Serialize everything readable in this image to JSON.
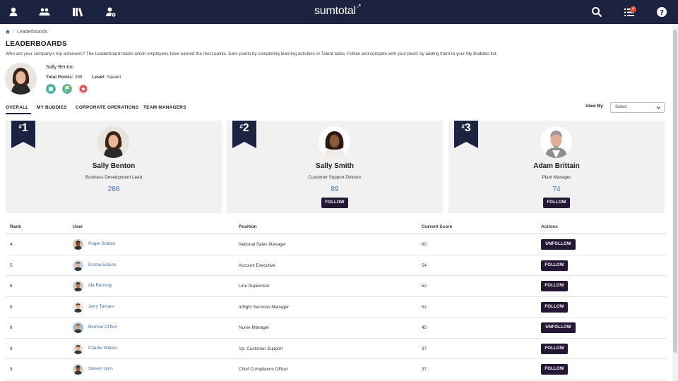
{
  "brand": {
    "name": "sumtotal"
  },
  "notifications": {
    "count": "4"
  },
  "breadcrumb": {
    "current": "Leaderboards"
  },
  "page": {
    "title": "LEADERBOARDS",
    "description": "Who are your company's top achievers? The Leaderboard tracks which employees have earned the most points. Earn points by completing learning activities or Talent tasks. Follow and compete with your peers by adding them to your My Buddies list."
  },
  "me": {
    "name": "Sally Benton",
    "total_points_label": "Total Points:",
    "total_points": "288",
    "level_label": "Level:",
    "level": "Savant"
  },
  "tabs": [
    "OVERALL",
    "MY BUDDIES",
    "CORPORATE OPERATIONS",
    "TEAM MANAGERS"
  ],
  "view_by": {
    "label": "View By",
    "selected": "Select"
  },
  "top3": [
    {
      "rank": "1",
      "name": "Sally Benton",
      "title": "Business Development Lead",
      "score": "288",
      "action": ""
    },
    {
      "rank": "2",
      "name": "Sally Smith",
      "title": "Customer Support Director",
      "score": "89",
      "action": "FOLLOW"
    },
    {
      "rank": "3",
      "name": "Adam Brittain",
      "title": "Plant Manager",
      "score": "74",
      "action": "FOLLOW"
    }
  ],
  "table": {
    "headers": {
      "rank": "Rank",
      "user": "User",
      "position": "Position",
      "score": "Current Score",
      "actions": "Actions"
    },
    "rows": [
      {
        "rank": "4",
        "user": "Roger Bolden",
        "position": "National Sales Manager",
        "score": "60",
        "action": "UNFOLLOW"
      },
      {
        "rank": "5",
        "user": "Emma Edison",
        "position": "Account Executive",
        "score": "54",
        "action": "FOLLOW"
      },
      {
        "rank": "6",
        "user": "Ida Ramsay",
        "position": "Line Supervisor",
        "score": "52",
        "action": "FOLLOW"
      },
      {
        "rank": "6",
        "user": "Jerry Tamaro",
        "position": "Inflight Services Manager",
        "score": "52",
        "action": "FOLLOW"
      },
      {
        "rank": "8",
        "user": "Bernice Clifton",
        "position": "Nurse Manager",
        "score": "45",
        "action": "UNFOLLOW"
      },
      {
        "rank": "9",
        "user": "Charlie Waters",
        "position": "Vp. Customer Support",
        "score": "37",
        "action": "FOLLOW"
      },
      {
        "rank": "9",
        "user": "Steven Lynn",
        "position": "Chief Compliance Officer",
        "score": "37",
        "action": "FOLLOW"
      }
    ]
  },
  "colors": {
    "topbar": "#1c2340",
    "button": "#231733",
    "link": "#3f6ea8",
    "badge": "#e8472e"
  },
  "icons": {
    "topbar_left": [
      "person-icon",
      "group-icon",
      "library-icon",
      "user-settings-icon"
    ],
    "topbar_right": [
      "search-icon",
      "task-list-icon",
      "help-icon"
    ],
    "me_badges": [
      "certificate-badge-icon",
      "flag-badge-icon",
      "star-badge-icon"
    ]
  }
}
